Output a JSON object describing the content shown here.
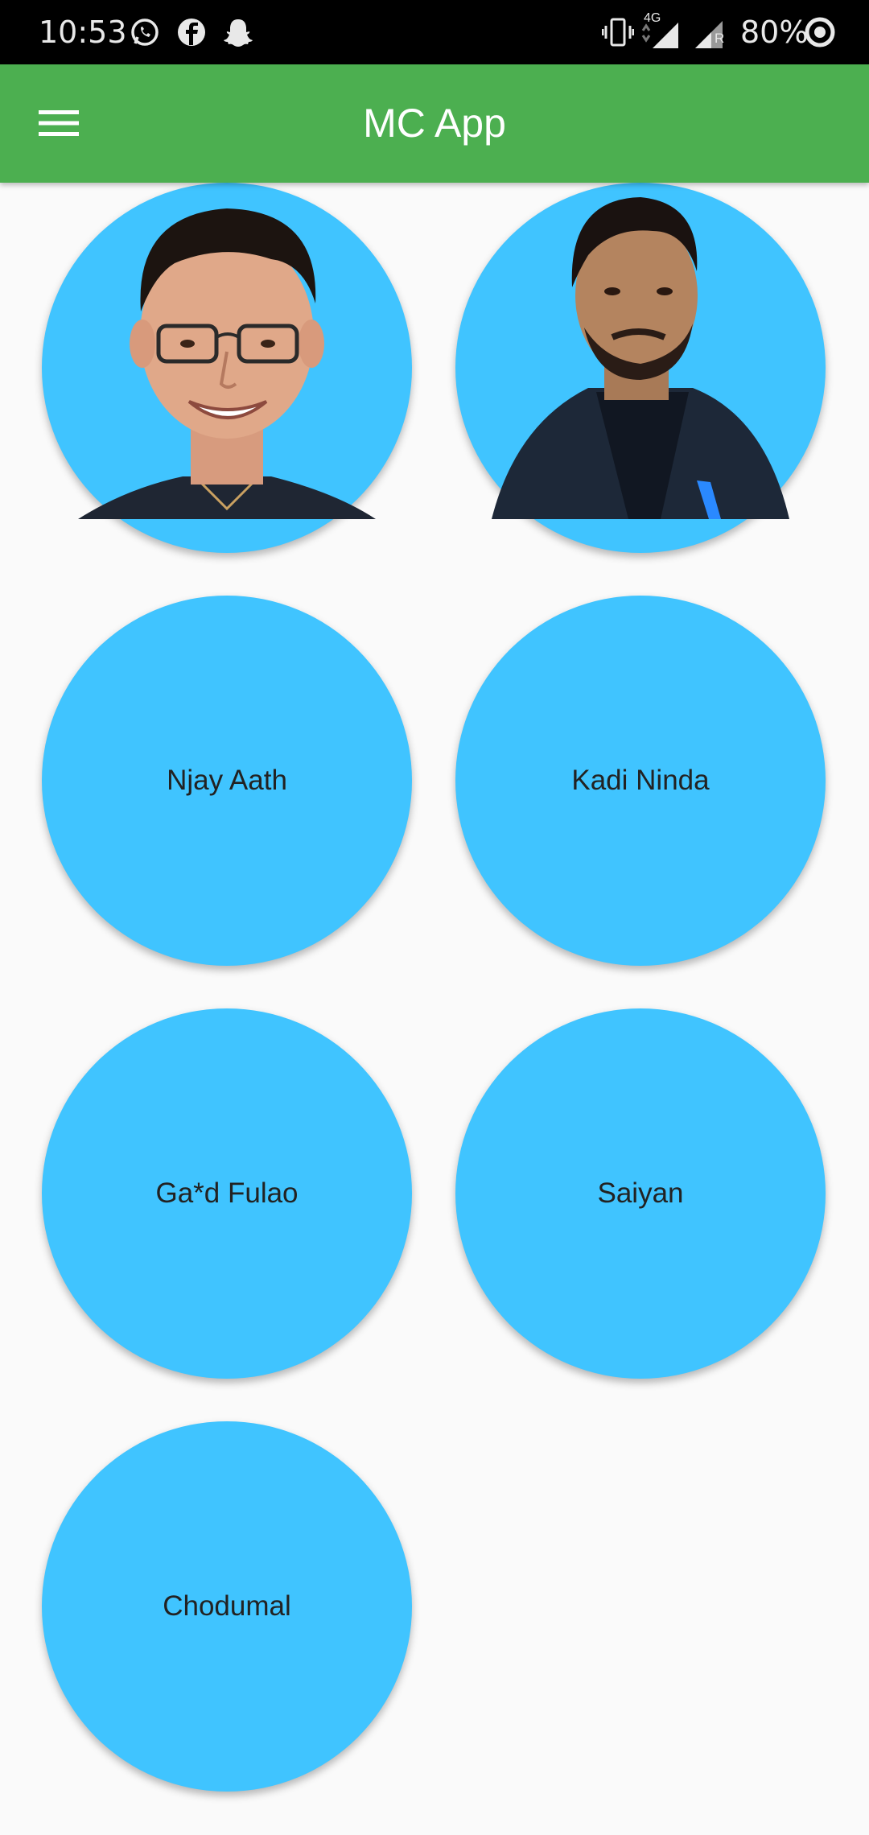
{
  "status_bar": {
    "time": "10:53",
    "notification_icons": [
      "whatsapp-icon",
      "facebook-icon",
      "snapchat-icon"
    ],
    "network": "4G",
    "roaming": "R",
    "battery": "80%"
  },
  "app_bar": {
    "title": "MC App",
    "menu_icon": "hamburger-menu-icon",
    "color": "#4caf50"
  },
  "tiles": [
    {
      "type": "photo",
      "alt": "person-1-photo"
    },
    {
      "type": "photo",
      "alt": "person-2-photo"
    },
    {
      "type": "text",
      "label": "Njay Aath"
    },
    {
      "type": "text",
      "label": "Kadi Ninda"
    },
    {
      "type": "text",
      "label": "Ga*d Fulao"
    },
    {
      "type": "text",
      "label": "Saiyan"
    },
    {
      "type": "text",
      "label": "Chodumal"
    }
  ],
  "colors": {
    "tile": "#40c4ff",
    "background": "#fafafa"
  }
}
